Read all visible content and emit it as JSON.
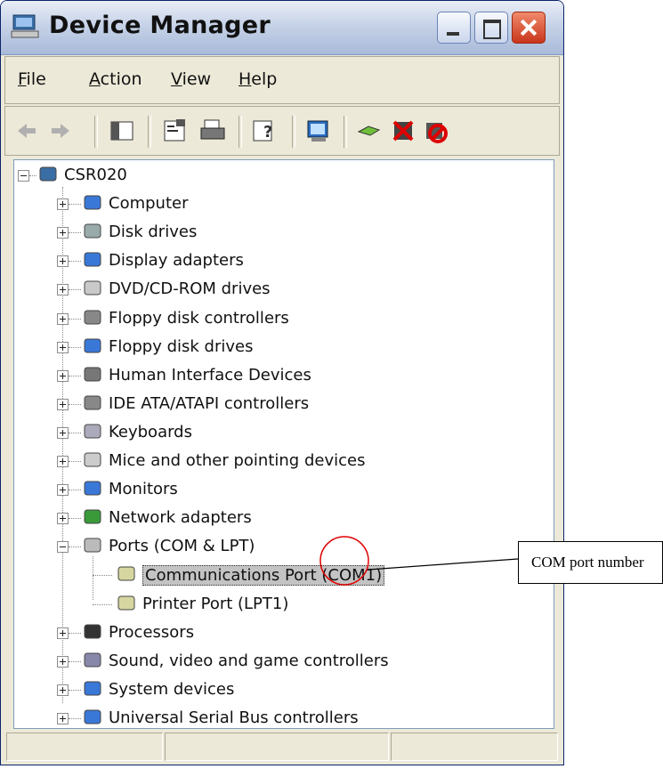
{
  "window": {
    "title": "Device Manager"
  },
  "menu": [
    {
      "label": "File",
      "accel": "F",
      "rest": "ile"
    },
    {
      "label": "Action",
      "accel": "A",
      "rest": "ction"
    },
    {
      "label": "View",
      "accel": "V",
      "rest": "iew"
    },
    {
      "label": "Help",
      "accel": "H",
      "rest": "elp"
    }
  ],
  "toolbar": [
    "back-icon",
    "forward-icon",
    "show-hide-console-tree-icon",
    "properties-icon",
    "print-icon",
    "help-icon",
    "scan-hardware-icon",
    "update-driver-icon",
    "uninstall-icon",
    "disable-icon"
  ],
  "tree": {
    "root": "CSR020",
    "categories": [
      "Computer",
      "Disk drives",
      "Display adapters",
      "DVD/CD-ROM drives",
      "Floppy disk controllers",
      "Floppy disk drives",
      "Human Interface Devices",
      "IDE ATA/ATAPI controllers",
      "Keyboards",
      "Mice and other pointing devices",
      "Monitors",
      "Network adapters",
      "Ports (COM & LPT)",
      "Processors",
      "Sound, video and game controllers",
      "System devices",
      "Universal Serial Bus controllers"
    ],
    "ports_children": [
      "Communications Port (COM1)",
      "Printer Port (LPT1)"
    ],
    "selected": "Communications Port (COM1)"
  },
  "callout": {
    "text": "COM port number"
  },
  "colors": {
    "selection": "#c3c3c3",
    "callout_circle": "#e00000",
    "titlebar": "#c3d0e6"
  }
}
